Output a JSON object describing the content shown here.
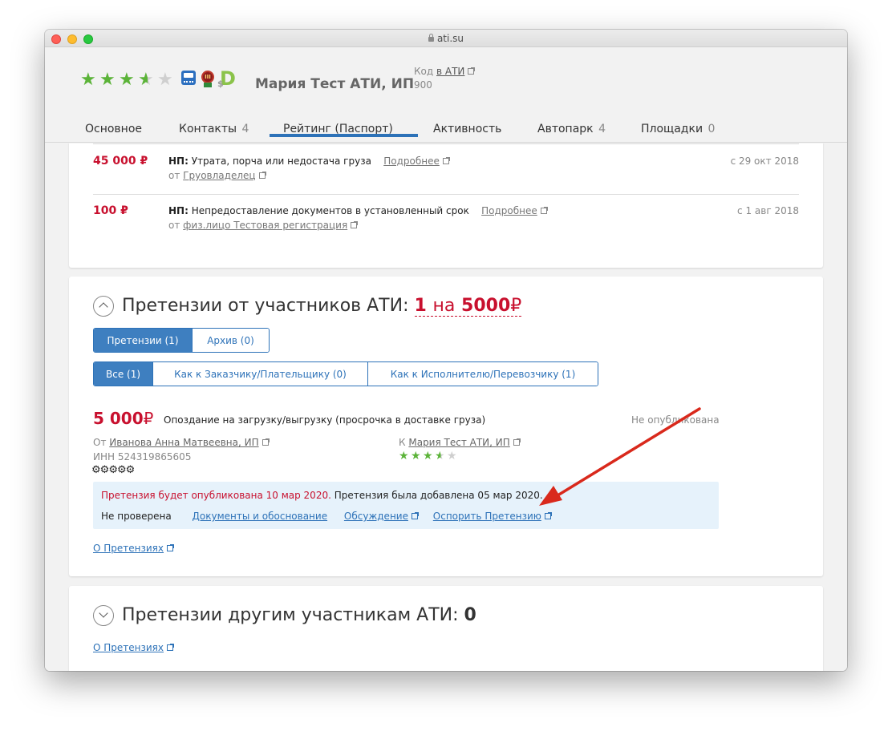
{
  "browser": {
    "url": "ati.su"
  },
  "header": {
    "company_name": "Мария Тест АТИ, ИП",
    "code_prefix": "Код",
    "code_link": "в АТИ",
    "code_value": "900"
  },
  "tabs": [
    {
      "label": "Основное",
      "count": ""
    },
    {
      "label": "Контакты",
      "count": "4"
    },
    {
      "label": "Рейтинг (Паспорт)",
      "count": ""
    },
    {
      "label": "Активность",
      "count": ""
    },
    {
      "label": "Автопарк",
      "count": "4"
    },
    {
      "label": "Площадки",
      "count": "0"
    }
  ],
  "penalties": [
    {
      "amount": "45 000 ₽",
      "np": "НП:",
      "text": "Утрата, порча или недостача груза",
      "more": "Подробнее",
      "from_prefix": "от",
      "from_name": "Груовладелец",
      "date": "с 29 окт 2018"
    },
    {
      "amount": "100 ₽",
      "np": "НП:",
      "text": "Непредоставление документов в установленный срок",
      "more": "Подробнее",
      "from_prefix": "от",
      "from_name": "физ.лицо Тестовая регистрация",
      "date": "с 1 авг 2018"
    }
  ],
  "claims_section": {
    "title": "Претензии от участников АТИ:",
    "count": "1",
    "on": "на",
    "sum": "5000",
    "currency": "₽",
    "tabs1": [
      {
        "label": "Претензии (1)"
      },
      {
        "label": "Архив (0)"
      }
    ],
    "tabs2": [
      {
        "label": "Все (1)"
      },
      {
        "label": "Как к Заказчику/Плательщику (0)"
      },
      {
        "label": "Как к Исполнителю/Перевозчику (1)"
      }
    ],
    "claim": {
      "amount": "5 000",
      "currency": "₽",
      "description": "Опоздание на загрузку/выгрузку (просрочка в доставке груза)",
      "status": "Не опубликована",
      "from_prefix": "От",
      "from_name": "Иванова Анна Матвеевна, ИП",
      "inn": "ИНН 524319865605",
      "to_prefix": "К",
      "to_name": "Мария Тест АТИ, ИП",
      "publish_notice": "Претензия будет опубликована 10 мар 2020.",
      "added_notice": "Претензия была добавлена 05 мар 2020.",
      "check_status": "Не проверена",
      "link_docs": "Документы и обоснование",
      "link_discussion": "Обсуждение",
      "link_dispute": "Оспорить Претензию"
    },
    "about_link": "О Претензиях"
  },
  "claims_other_section": {
    "title": "Претензии другим участникам АТИ:",
    "count": "0",
    "about_link": "О Претензиях"
  },
  "ratings": {
    "header_stars": 3.5,
    "claim_stars": 3.5
  },
  "colors": {
    "accent_blue": "#2d72b8",
    "alert_red": "#c8102e",
    "star_green": "#5bb338",
    "arrow_red": "#d9291c"
  }
}
